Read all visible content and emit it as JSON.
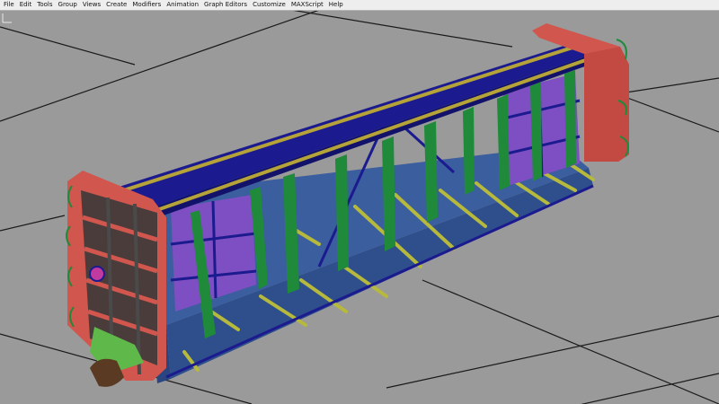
{
  "menu": {
    "items": [
      "File",
      "Edit",
      "Tools",
      "Group",
      "Views",
      "Create",
      "Modifiers",
      "Animation",
      "Graph Editors",
      "Customize",
      "MAXScript",
      "Help"
    ]
  },
  "viewport": {
    "model": "boxcar-frame",
    "colors": {
      "background": "#9a9a9a",
      "grid": "#1a1a1a",
      "floor": "#3b5e9e",
      "side_panel": "#7d4fc2",
      "end_wall": "#d0564e",
      "roof": "#1b1b8f",
      "roof_rail": "#b5a33a",
      "stake": "#1f8a3a",
      "deck_slat": "#b7b93c",
      "coupler": "#5a3a22",
      "step_plate": "#5fb84a"
    }
  }
}
